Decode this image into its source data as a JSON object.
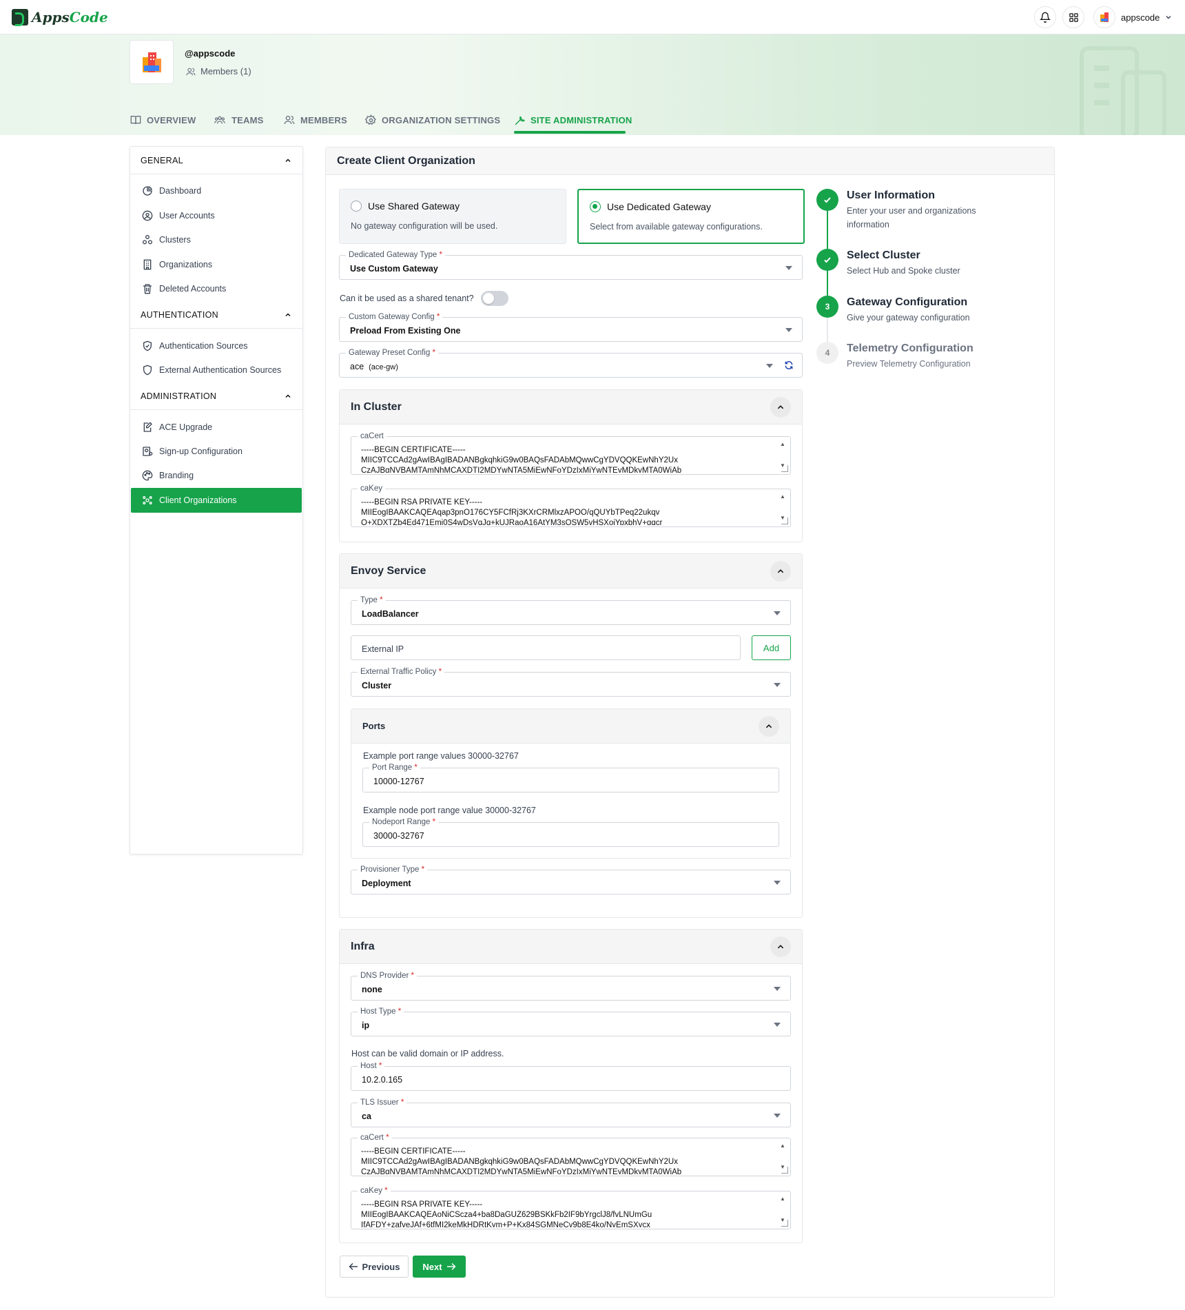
{
  "header": {
    "logo_apps": "Apps",
    "logo_code": "Code",
    "username": "appscode"
  },
  "org": {
    "name": "@appscode",
    "members": "Members (1)"
  },
  "tabs": [
    "OVERVIEW",
    "TEAMS",
    "MEMBERS",
    "ORGANIZATION SETTINGS",
    "SITE ADMINISTRATION"
  ],
  "sidebar": {
    "general": {
      "title": "GENERAL",
      "items": [
        "Dashboard",
        "User Accounts",
        "Clusters",
        "Organizations",
        "Deleted Accounts"
      ]
    },
    "authentication": {
      "title": "AUTHENTICATION",
      "items": [
        "Authentication Sources",
        "External Authentication Sources"
      ]
    },
    "administration": {
      "title": "ADMINISTRATION",
      "items": [
        "ACE Upgrade",
        "Sign-up Configuration",
        "Branding",
        "Client Organizations"
      ]
    }
  },
  "main": {
    "title": "Create Client Organization",
    "gateway_options": [
      {
        "label": "Use Shared Gateway",
        "desc": "No gateway configuration will be used.",
        "selected": false
      },
      {
        "label": "Use Dedicated Gateway",
        "desc": "Select from available gateway configurations.",
        "selected": true
      }
    ],
    "dedicated_gateway_type": {
      "label": "Dedicated Gateway Type",
      "value": "Use Custom Gateway"
    },
    "shared_tenant_label": "Can it be used as a shared tenant?",
    "custom_gateway_config": {
      "label": "Custom Gateway Config",
      "value": "Preload From Existing One"
    },
    "gateway_preset_config": {
      "label": "Gateway Preset Config",
      "value": "ace",
      "value_sub": "(ace-gw)"
    },
    "in_cluster": {
      "title": "In Cluster",
      "cacert": {
        "label": "caCert",
        "value": "-----BEGIN CERTIFICATE-----\nMIIC9TCCAd2gAwIBAgIBADANBgkqhkiG9w0BAQsFADAbMQwwCgYDVQQKEwNhY2Ux\nCzAJBgNVBAMTAmNhMCAXDTI2MDYwNTA5MjEwNFoYDzIxMjYwNTEyMDkyMTA0WjAb"
      },
      "cakey": {
        "label": "caKey",
        "value": "-----BEGIN RSA PRIVATE KEY-----\nMIIEogIBAAKCAQEAqap3pnO176CY5FCfRj3KXrCRMlxzAPOO/qQUYbTPeq22ukqv\nO+XDXTZb4Ed471Emi0S4wDsVqJq+kUJRaoA16AtYM3sOSW5vHSXoiYpxbhV+gqcr"
      }
    },
    "envoy": {
      "title": "Envoy Service",
      "type": {
        "label": "Type",
        "value": "LoadBalancer"
      },
      "external_ip_placeholder": "External IP",
      "add_label": "Add",
      "traffic_policy": {
        "label": "External Traffic Policy",
        "value": "Cluster"
      },
      "ports": {
        "title": "Ports",
        "port_hint": "Example port range values 30000-32767",
        "port_range": {
          "label": "Port Range",
          "value": "10000-12767"
        },
        "nodeport_hint": "Example node port range value 30000-32767",
        "nodeport_range": {
          "label": "Nodeport Range",
          "value": "30000-32767"
        }
      },
      "provisioner": {
        "label": "Provisioner Type",
        "value": "Deployment"
      }
    },
    "infra": {
      "title": "Infra",
      "dns": {
        "label": "DNS Provider",
        "value": "none"
      },
      "host_type": {
        "label": "Host Type",
        "value": "ip"
      },
      "host_hint": "Host can be valid domain or IP address.",
      "host": {
        "label": "Host",
        "value": "10.2.0.165"
      },
      "tls_issuer": {
        "label": "TLS Issuer",
        "value": "ca"
      },
      "cacert": {
        "label": "caCert",
        "value": "-----BEGIN CERTIFICATE-----\nMIIC9TCCAd2gAwIBAgIBADANBgkqhkiG9w0BAQsFADAbMQwwCgYDVQQKEwNhY2Ux\nCzAJBgNVBAMTAmNhMCAXDTI2MDYwNTA5MjEwNFoYDzIxMjYwNTEyMDkyMTA0WjAb"
      },
      "cakey": {
        "label": "caKey",
        "value": "-----BEGIN RSA PRIVATE KEY-----\nMIIEogIBAAKCAQEAoNiCScza4+ba8DaGUZ629BSKkFb2IF9bYrgclJ8/fvLNUmGu\nIfAFDY+zafveJAf+6tfMI2keMkHDRtKym+P+Kx84SGMNeCv9b8E4ko/NyEmSXycx"
      }
    },
    "previous_label": "Previous",
    "next_label": "Next"
  },
  "steps": [
    {
      "num": "1",
      "title": "User Information",
      "desc": "Enter your user and organizations information",
      "status": "done"
    },
    {
      "num": "2",
      "title": "Select Cluster",
      "desc": "Select Hub and Spoke cluster",
      "status": "done"
    },
    {
      "num": "3",
      "title": "Gateway Configuration",
      "desc": "Give your gateway configuration",
      "status": "current"
    },
    {
      "num": "4",
      "title": "Telemetry Configuration",
      "desc": "Preview Telemetry Configuration",
      "status": "todo"
    }
  ],
  "colors": {
    "accent": "#16a34a",
    "border": "#e5e7eb",
    "required": "#dc2626"
  }
}
